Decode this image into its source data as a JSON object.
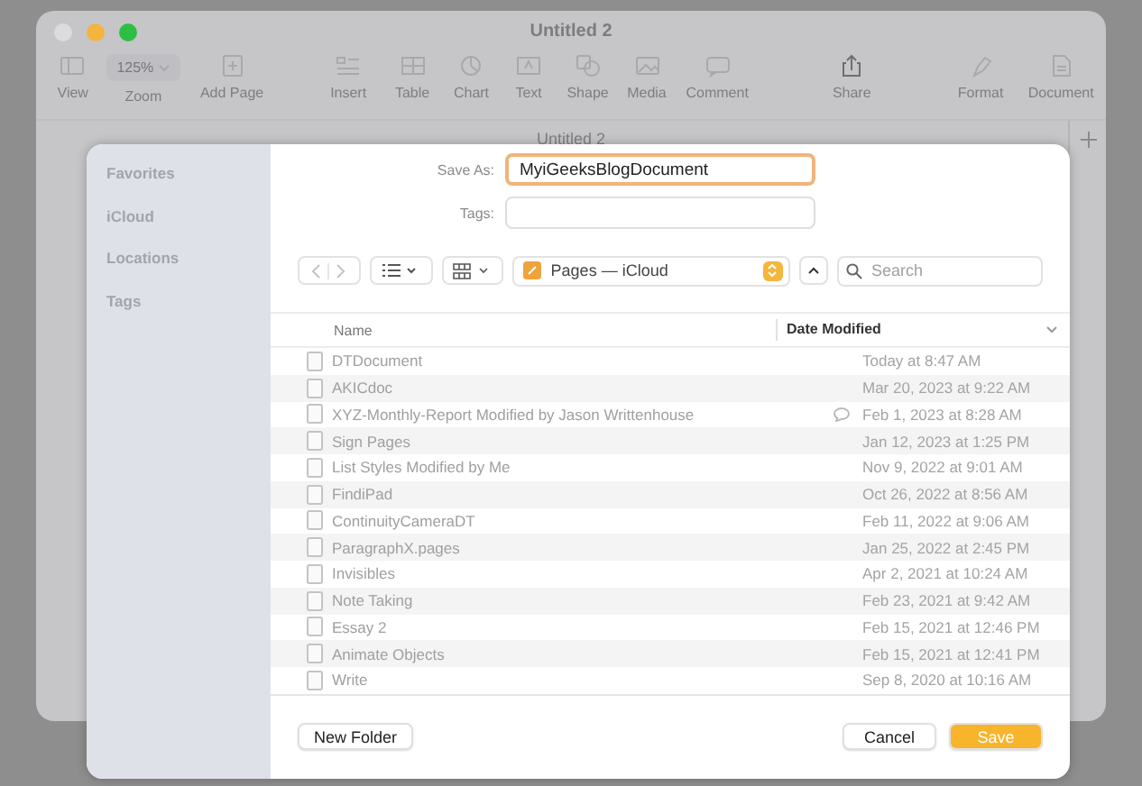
{
  "window": {
    "title": "Untitled 2",
    "tab_title": "Untitled 2",
    "zoom": "125%"
  },
  "toolbar": [
    {
      "label": "View",
      "kind": "view"
    },
    {
      "label": "Zoom",
      "kind": "zoom"
    },
    {
      "label": "Add Page",
      "kind": "add"
    },
    {
      "label": "Insert",
      "kind": "insert"
    },
    {
      "label": "Table",
      "kind": "table"
    },
    {
      "label": "Chart",
      "kind": "chart"
    },
    {
      "label": "Text",
      "kind": "text"
    },
    {
      "label": "Shape",
      "kind": "shape"
    },
    {
      "label": "Media",
      "kind": "media"
    },
    {
      "label": "Comment",
      "kind": "comment"
    },
    {
      "label": "Share",
      "kind": "share"
    },
    {
      "label": "Format",
      "kind": "format"
    },
    {
      "label": "Document",
      "kind": "document"
    }
  ],
  "sidebar": {
    "items": [
      "Favorites",
      "iCloud",
      "Locations",
      "Tags"
    ]
  },
  "save_as": {
    "label": "Save As:",
    "value": "MyiGeeksBlogDocument"
  },
  "tags": {
    "label": "Tags:"
  },
  "location": "Pages — iCloud",
  "search": {
    "placeholder": "Search"
  },
  "table": {
    "columns": [
      "Name",
      "Date Modified"
    ],
    "rows": [
      {
        "name": "DTDocument",
        "date": "Today at 8:47 AM",
        "comment": false
      },
      {
        "name": "AKICdoc",
        "date": "Mar 20, 2023 at 9:22 AM",
        "comment": false
      },
      {
        "name": "XYZ-Monthly-Report",
        "note": "Modified by Jason Writtenhouse",
        "date": "Feb 1, 2023 at 8:28 AM",
        "comment": true
      },
      {
        "name": "Sign Pages",
        "date": "Jan 12, 2023 at 1:25 PM",
        "comment": false
      },
      {
        "name": "List Styles",
        "note": "Modified by Me",
        "date": "Nov 9, 2022 at 9:01 AM",
        "comment": false
      },
      {
        "name": "FindiPad",
        "date": "Oct 26, 2022 at 8:56 AM",
        "comment": false
      },
      {
        "name": "ContinuityCameraDT",
        "date": "Feb 11, 2022 at 9:06 AM",
        "comment": false
      },
      {
        "name": "ParagraphX.pages",
        "date": "Jan 25, 2022 at 2:45 PM",
        "comment": false
      },
      {
        "name": "Invisibles",
        "date": "Apr 2, 2021 at 10:24 AM",
        "comment": false
      },
      {
        "name": "Note Taking",
        "date": "Feb 23, 2021 at 9:42 AM",
        "comment": false
      },
      {
        "name": "Essay 2",
        "date": "Feb 15, 2021 at 12:46 PM",
        "comment": false
      },
      {
        "name": "Animate Objects",
        "date": "Feb 15, 2021 at 12:41 PM",
        "comment": false
      },
      {
        "name": "Write",
        "date": "Sep 8, 2020 at 10:16 AM",
        "comment": false
      }
    ]
  },
  "buttons": {
    "new_folder": "New Folder",
    "cancel": "Cancel",
    "save": "Save"
  }
}
